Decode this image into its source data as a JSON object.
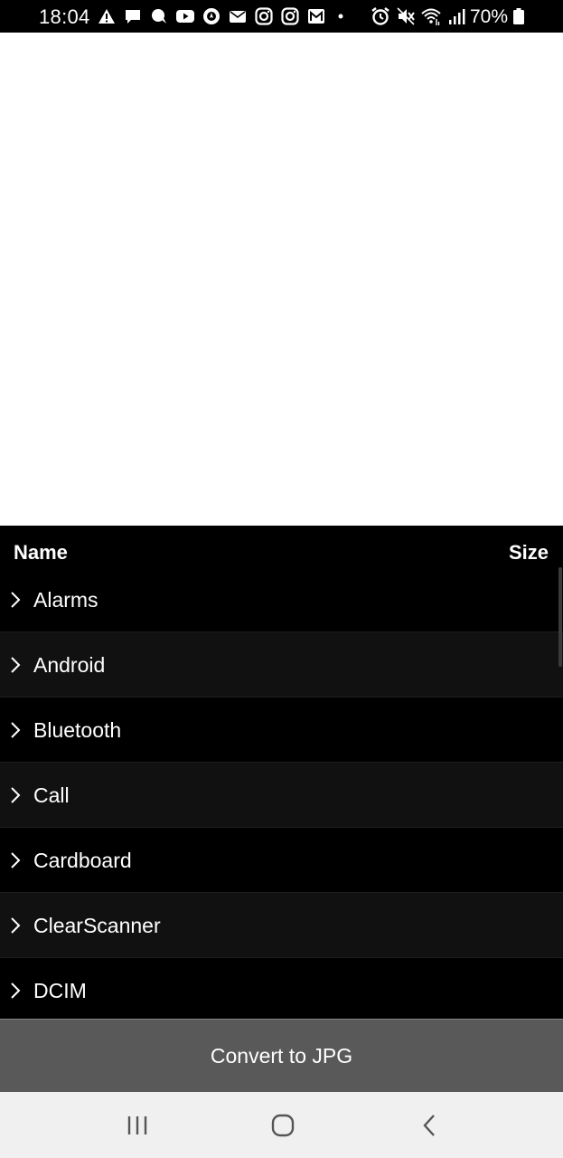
{
  "status_bar": {
    "time": "18:04",
    "battery_percent": "70%",
    "notification_icons": [
      "warning-icon",
      "message-icon",
      "chat-bubble-icon",
      "youtube-icon",
      "gps-icon",
      "email-icon",
      "instagram-icon",
      "instagram-icon",
      "gmail-icon",
      "dot-icon"
    ],
    "system_icons": [
      "alarm-icon",
      "mute-icon",
      "wifi-icon",
      "signal-icon"
    ]
  },
  "file_list": {
    "header": {
      "name_label": "Name",
      "size_label": "Size"
    },
    "items": [
      {
        "label": "Alarms"
      },
      {
        "label": "Android"
      },
      {
        "label": "Bluetooth"
      },
      {
        "label": "Call"
      },
      {
        "label": "Cardboard"
      },
      {
        "label": "ClearScanner"
      },
      {
        "label": "DCIM"
      }
    ]
  },
  "actions": {
    "convert_label": "Convert to JPG"
  },
  "colors": {
    "panel_background": "#000000",
    "alt_row_background": "#111111",
    "button_background": "#595959",
    "nav_background": "#f0f0f0"
  }
}
